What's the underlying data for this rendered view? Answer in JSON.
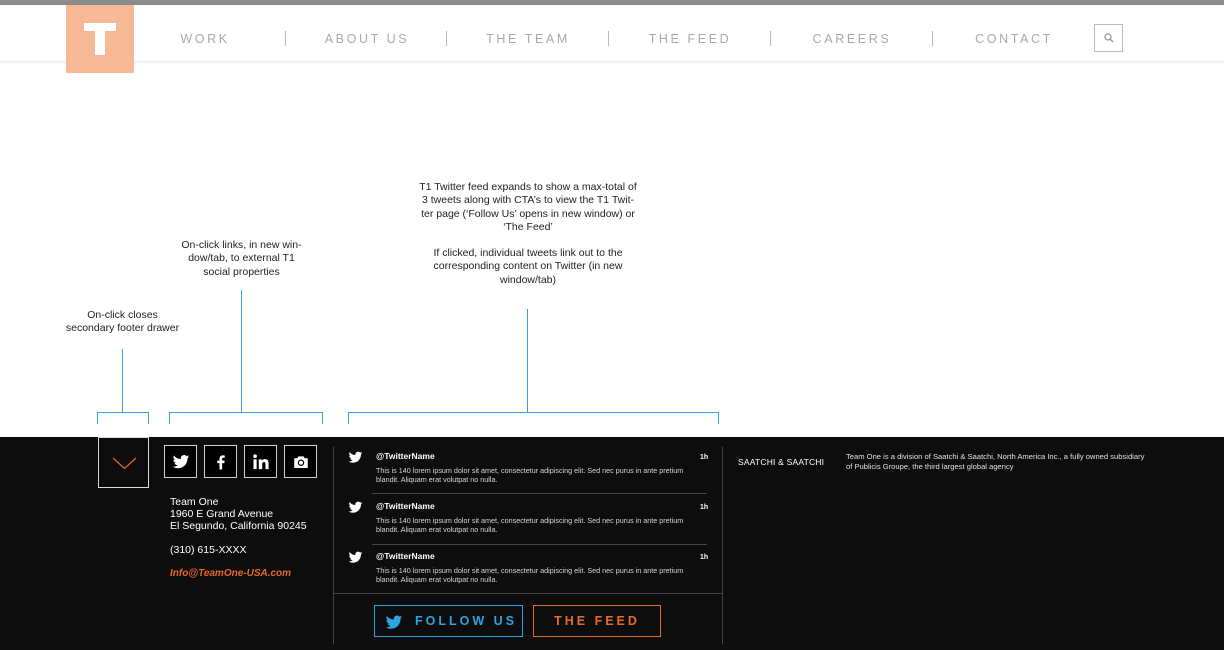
{
  "header": {
    "logo_letter": "T",
    "nav": [
      "WORK",
      "ABOUT US",
      "THE TEAM",
      "THE FEED",
      "CAREERS",
      "CONTACT"
    ],
    "search_icon": "search-icon"
  },
  "annotations": {
    "drawer": "On-click closes\nsecondary footer drawer",
    "social": "On-click links, in new win-\ndow/tab, to external T1\nsocial properties",
    "twitter_1": "T1 Twitter feed expands to show a max-total of\n3 tweets along with CTA’s to view the T1 Twit-\nter page (‘Follow Us’ opens in new window) or\n‘The Feed’",
    "twitter_2": "If clicked, individual tweets link out to the\ncorresponding content on Twitter (in new\nwindow/tab)"
  },
  "footer": {
    "drawer_icon": "chevron-down-icon",
    "social_icons": [
      "twitter-icon",
      "facebook-icon",
      "linkedin-icon",
      "instagram-icon"
    ],
    "address": {
      "name": "Team One",
      "street": "1960 E Grand Avenue",
      "city": "El Segundo, California 90245",
      "phone": "(310) 615-XXXX",
      "email": "Info@TeamOne-USA.com"
    },
    "tweets": [
      {
        "name": "@TwitterName",
        "time": "1h",
        "text": "This is 140 lorem ipsum dolor sit amet, consectetur adipiscing elit. Sed nec purus in ante pretium blandit. Aliquam erat volutpat no nulla."
      },
      {
        "name": "@TwitterName",
        "time": "1h",
        "text": "This is 140 lorem ipsum dolor sit amet, consectetur adipiscing elit. Sed nec purus in ante pretium blandit. Aliquam erat volutpat no nulla."
      },
      {
        "name": "@TwitterName",
        "time": "1h",
        "text": "This is 140 lorem ipsum dolor sit amet, consectetur adipiscing elit. Sed nec purus in ante pretium blandit. Aliquam erat volutpat no nulla."
      }
    ],
    "follow_label": "FOLLOW US",
    "feed_label": "THE FEED",
    "saatchi": "SAATCHI & SAATCHI",
    "division": "Team One is a division of Saatchi & Saatchi, North America Inc., a fully owned subsidiary of Publicis Groupe, the third largest global agency"
  },
  "colors": {
    "logo": "#f7b896",
    "annotation_line": "#3aa0d6",
    "twitter_blue": "#2ea3e0",
    "accent_orange": "#e8692c",
    "footer_bg": "#0d0d0d"
  }
}
